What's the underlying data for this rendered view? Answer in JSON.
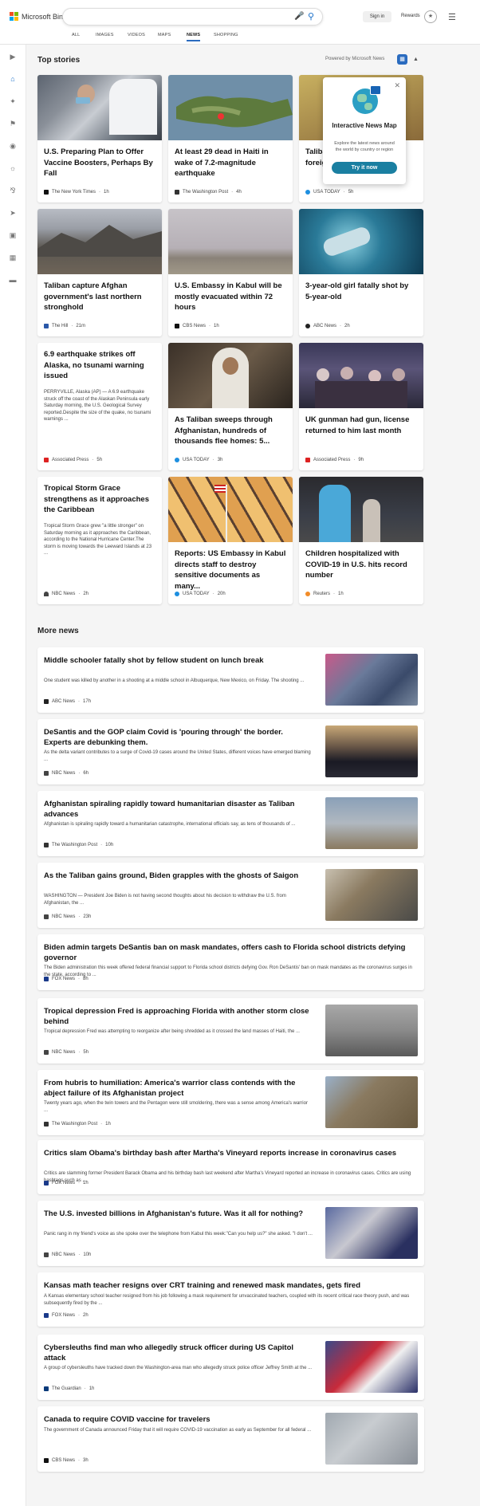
{
  "header": {
    "brand": "Microsoft Bing",
    "signin_label": "Sign in",
    "rewards_label": "Rewards",
    "tabs": [
      "ALL",
      "IMAGES",
      "VIDEOS",
      "MAPS",
      "NEWS",
      "SHOPPING"
    ],
    "active_tab": "NEWS"
  },
  "top_stories": {
    "heading": "Top stories",
    "powered_by": "Powered by Microsoft News",
    "cards": [
      {
        "title": "U.S. Preparing Plan to Offer Vaccine Boosters, Perhaps By Fall",
        "source": "The New York Times",
        "time": "1h",
        "snippet": ""
      },
      {
        "title": "At least 29 dead in Haiti in wake of 7.2-magnitude earthquake",
        "source": "The Washington Post",
        "time": "4h",
        "snippet": ""
      },
      {
        "title": "Taliban captures... tests... foreig...",
        "source": "USA TODAY",
        "time": "5h",
        "snippet": ""
      },
      {
        "title": "Taliban capture Afghan government's last northern stronghold",
        "source": "The Hill",
        "time": "21m",
        "snippet": ""
      },
      {
        "title": "U.S. Embassy in Kabul will be mostly evacuated within 72 hours",
        "source": "CBS News",
        "time": "1h",
        "snippet": ""
      },
      {
        "title": "3-year-old girl fatally shot by 5-year-old",
        "source": "ABC News",
        "time": "2h",
        "snippet": ""
      },
      {
        "title": "6.9 earthquake strikes off Alaska, no tsunami warning issued",
        "source": "Associated Press",
        "time": "5h",
        "snippet": "PERRYVILLE, Alaska (AP) — A 6.9 earthquake struck off the coast of the Alaskan Peninsula early Saturday morning, the U.S. Geological Survey reported.Despite the size of the quake, no tsunami warnings ..."
      },
      {
        "title": "As Taliban sweeps through Afghanistan, hundreds of thousands flee homes: 5...",
        "source": "USA TODAY",
        "time": "3h",
        "snippet": ""
      },
      {
        "title": "UK gunman had gun, license returned to him last month",
        "source": "Associated Press",
        "time": "9h",
        "snippet": ""
      },
      {
        "title": "Tropical Storm Grace strengthens as it approaches the Caribbean",
        "source": "NBC News",
        "time": "2h",
        "snippet": "Tropical Storm Grace grew \"a little stronger\" on Saturday morning as it approaches the Caribbean, according to the National Hurricane Center.The storm is moving towards the Leeward Islands at 23 ..."
      },
      {
        "title": "Reports: US Embassy in Kabul directs staff to destroy sensitive documents as many...",
        "source": "USA TODAY",
        "time": "20h",
        "snippet": ""
      },
      {
        "title": "Children hospitalized with COVID-19 in U.S. hits record number",
        "source": "Reuters",
        "time": "1h",
        "snippet": ""
      }
    ]
  },
  "popup": {
    "title": "Interactive News Map",
    "description": "Explore the latest news around the world by country or region",
    "button": "Try it now"
  },
  "more_news": {
    "heading": "More news",
    "items": [
      {
        "title": "Middle schooler fatally shot by fellow student on lunch break",
        "snippet": "One student was killed by another in a shooting at a middle school in Albuquerque, New Mexico, on Friday. The shooting ...",
        "source": "ABC News",
        "time": "17h"
      },
      {
        "title": "DeSantis and the GOP claim Covid is 'pouring through' the border. Experts are debunking them.",
        "snippet": "As the delta variant contributes to a surge of Covid-19 cases around the United States, different voices have emerged blaming ...",
        "source": "NBC News",
        "time": "6h"
      },
      {
        "title": "Afghanistan spiraling rapidly toward humanitarian disaster as Taliban advances",
        "snippet": "Afghanistan is spiraling rapidly toward a humanitarian catastrophe, international officials say, as tens of thousands of ...",
        "source": "The Washington Post",
        "time": "10h"
      },
      {
        "title": "As the Taliban gains ground, Biden grapples with the ghosts of Saigon",
        "snippet": "WASHINGTON — President Joe Biden is not having second thoughts about his decision to withdraw the U.S. from Afghanistan, the ...",
        "source": "NBC News",
        "time": "23h"
      },
      {
        "title": "Biden admin targets DeSantis ban on mask mandates, offers cash to Florida school districts defying governor",
        "snippet": "The Biden administration this week offered federal financial support to Florida school districts defying Gov. Ron DeSantis' ban on mask mandates as the coronavirus surges in the state, according to ...",
        "source": "FOX News",
        "time": "8h"
      },
      {
        "title": "Tropical depression Fred is approaching Florida with another storm close behind",
        "snippet": "Tropical depression Fred was attempting to reorganize after being shredded as it crossed the land masses of Haiti, the ...",
        "source": "NBC News",
        "time": "5h"
      },
      {
        "title": "From hubris to humiliation: America's warrior class contends with the abject failure of its Afghanistan project",
        "snippet": "Twenty years ago, when the twin towers and the Pentagon were still smoldering, there was a sense among America's warrior ...",
        "source": "The Washington Post",
        "time": "1h"
      },
      {
        "title": "Critics slam Obama's birthday bash after Martha's Vineyard reports increase in coronavirus cases",
        "snippet": "Critics are slamming former President Barack Obama and his birthday bash last weekend after Martha's Vineyard reported an increase in coronavirus cases. Critics are using hashtags such as ...",
        "source": "FOX News",
        "time": "1h"
      },
      {
        "title": "The U.S. invested billions in Afghanistan's future. Was it all for nothing?",
        "snippet": "Panic rang in my friend's voice as she spoke over the telephone from Kabul this week:\"Can you help us?\" she asked. \"I don't ...",
        "source": "NBC News",
        "time": "10h"
      },
      {
        "title": "Kansas math teacher resigns over CRT training and renewed mask mandates, gets fired",
        "snippet": "A Kansas elementary school teacher resigned from his job following a mask requirement for unvaccinated teachers, coupled with its recent critical race theory push, and was subsequently fired by the ...",
        "source": "FOX News",
        "time": "2h"
      },
      {
        "title": "Cybersleuths find man who allegedly struck officer during US Capitol attack",
        "snippet": "A group of cybersleuths have tracked down the Washington-area man who allegedly struck police officer Jeffrey Smith at the ...",
        "source": "The Guardian",
        "time": "1h"
      },
      {
        "title": "Canada to require COVID vaccine for travelers",
        "snippet": "The government of Canada announced Friday that it will require COVID-19 vaccination as early as September for all federal ...",
        "source": "CBS News",
        "time": "3h"
      }
    ]
  }
}
